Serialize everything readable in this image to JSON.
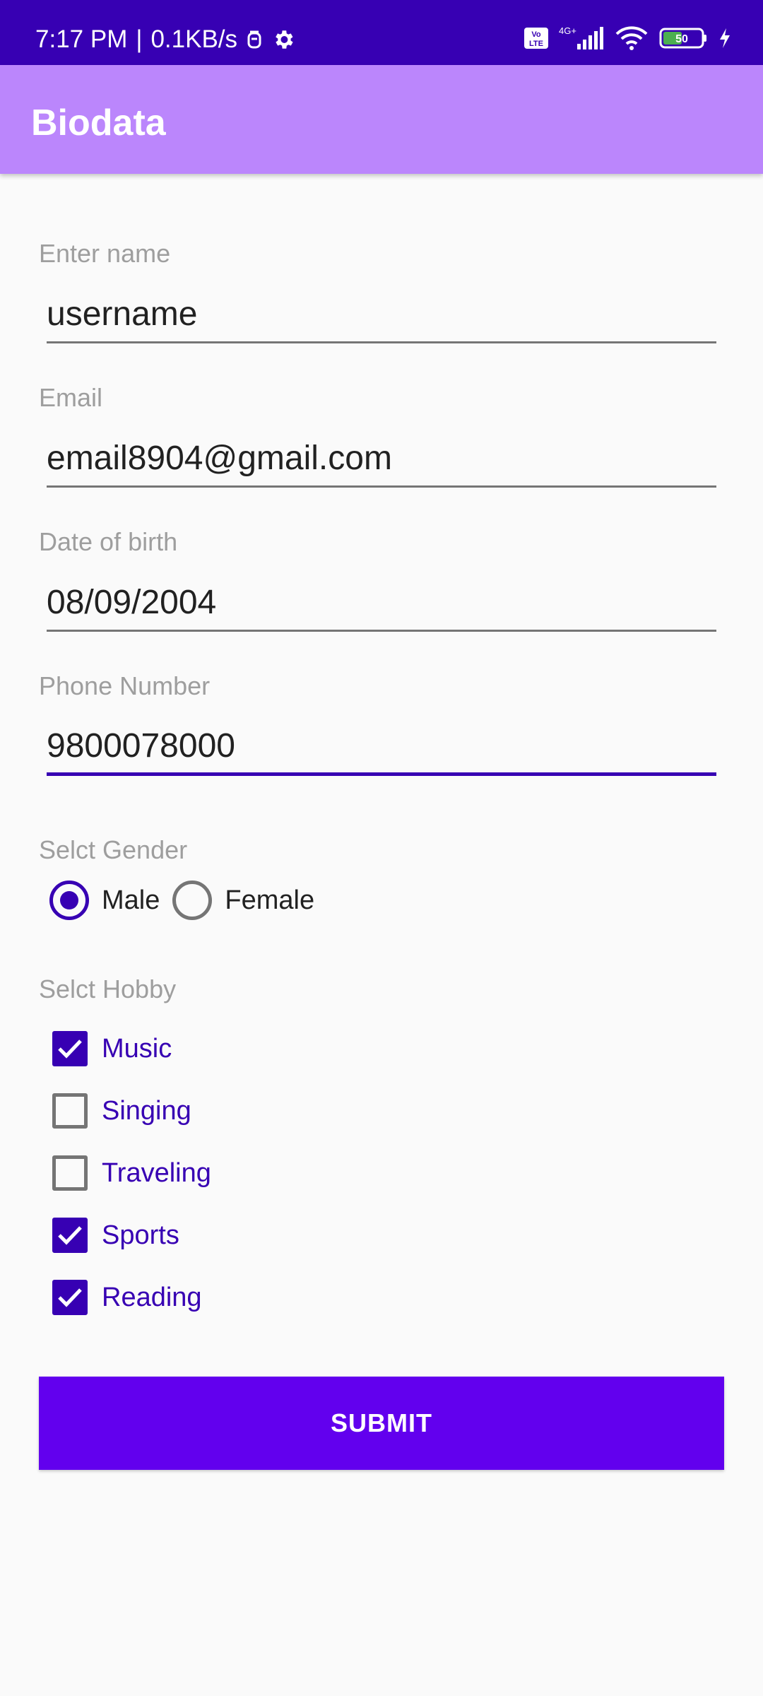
{
  "status_bar": {
    "time": "7:17 PM",
    "speed": "0.1KB/s",
    "network": "4G+",
    "battery": "50"
  },
  "app": {
    "title": "Biodata"
  },
  "form": {
    "name": {
      "label": "Enter name",
      "value": "username"
    },
    "email": {
      "label": "Email",
      "value": "email8904@gmail.com"
    },
    "dob": {
      "label": "Date of birth",
      "value": "08/09/2004"
    },
    "phone": {
      "label": "Phone Number",
      "value": "9800078000"
    },
    "gender": {
      "label": "Selct Gender",
      "options": [
        {
          "label": "Male",
          "checked": true
        },
        {
          "label": "Female",
          "checked": false
        }
      ]
    },
    "hobby": {
      "label": "Selct Hobby",
      "options": [
        {
          "label": "Music",
          "checked": true
        },
        {
          "label": "Singing",
          "checked": false
        },
        {
          "label": "Traveling",
          "checked": false
        },
        {
          "label": "Sports",
          "checked": true
        },
        {
          "label": "Reading",
          "checked": true
        }
      ]
    },
    "submit_label": "SUBMIT"
  },
  "colors": {
    "primary": "#6200EE",
    "primary_dark": "#3700B3",
    "app_bar": "#BB86FC",
    "background": "#FAFAFA"
  }
}
